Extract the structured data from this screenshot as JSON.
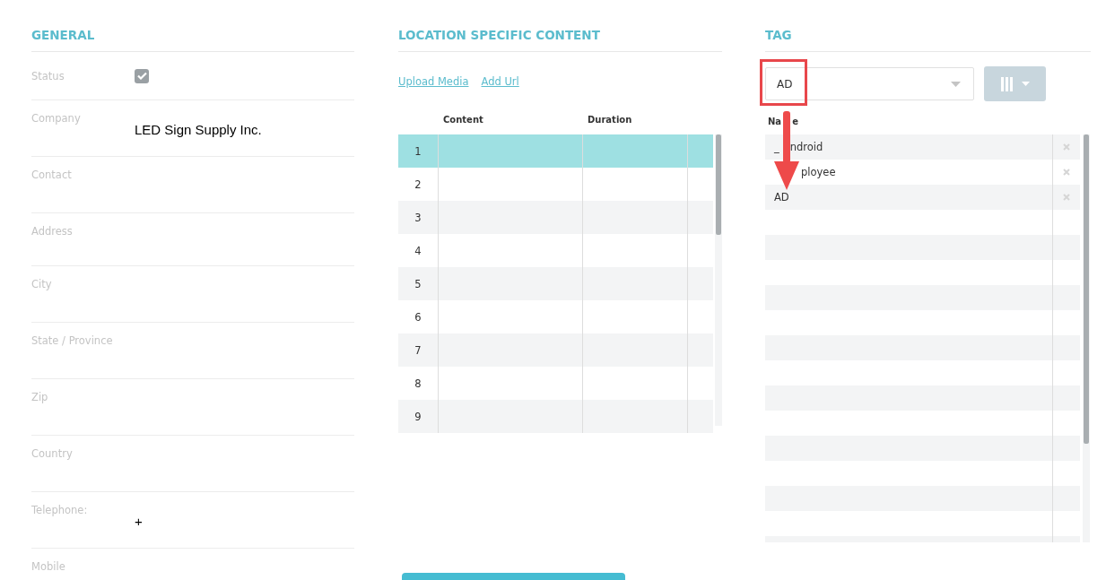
{
  "general": {
    "title": "GENERAL",
    "fields": [
      {
        "label": "Status",
        "kind": "checkbox",
        "checked": true
      },
      {
        "label": "Company",
        "kind": "text",
        "value": "LED Sign Supply Inc."
      },
      {
        "label": "Contact",
        "kind": "text"
      },
      {
        "label": "Address",
        "kind": "text"
      },
      {
        "label": "City",
        "kind": "text"
      },
      {
        "label": "State / Province",
        "kind": "text"
      },
      {
        "label": "Zip",
        "kind": "text"
      },
      {
        "label": "Country",
        "kind": "text"
      },
      {
        "label": "Telephone:",
        "kind": "text",
        "value": "+"
      },
      {
        "label": "Mobile",
        "kind": "text"
      }
    ]
  },
  "content": {
    "title": "LOCATION SPECIFIC CONTENT",
    "links": [
      "Upload Media",
      "Add Url"
    ],
    "columns": [
      "Content",
      "Duration"
    ],
    "rows": [
      {
        "number": "1",
        "selected": true
      },
      {
        "number": "2",
        "selected": false
      },
      {
        "number": "3",
        "selected": false
      },
      {
        "number": "4",
        "selected": false
      },
      {
        "number": "5",
        "selected": false
      },
      {
        "number": "6",
        "selected": false
      },
      {
        "number": "7",
        "selected": false
      },
      {
        "number": "8",
        "selected": false
      },
      {
        "number": "9",
        "selected": false
      }
    ]
  },
  "tag": {
    "title": "TAG",
    "select": {
      "value": "AD"
    },
    "list_header": {
      "kind": "split",
      "parts": [
        "Na",
        "e"
      ]
    },
    "tags": [
      {
        "kind": "split",
        "parts": [
          "_",
          "ndroid"
        ]
      },
      {
        "kind": "tail",
        "parts": [
          "ployee"
        ]
      },
      {
        "kind": "plain",
        "parts": [
          "AD"
        ]
      }
    ]
  }
}
